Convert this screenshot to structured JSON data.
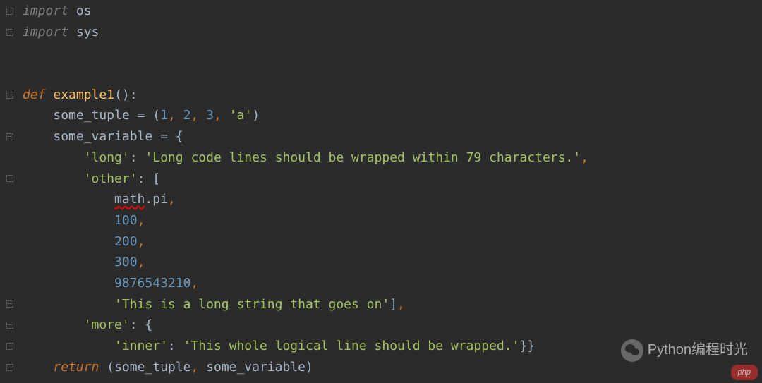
{
  "code": {
    "l1": {
      "kw": "import",
      "mod": " os"
    },
    "l2": {
      "kw": "import",
      "mod": " sys"
    },
    "l5": {
      "kw": "def ",
      "name": "example1",
      "parens": "()",
      "colon": ":"
    },
    "l6": {
      "indent": "    ",
      "var": "some_tuple ",
      "op": "= ",
      "open": "(",
      "n1": "1",
      "c1": ", ",
      "n2": "2",
      "c2": ", ",
      "n3": "3",
      "c3": ", ",
      "s1": "'a'",
      "close": ")"
    },
    "l7": {
      "indent": "    ",
      "var": "some_variable ",
      "op": "= ",
      "open": "{"
    },
    "l8": {
      "indent": "        ",
      "key": "'long'",
      "colon": ": ",
      "val": "'Long code lines should be wrapped within 79 characters.'",
      "comma": ","
    },
    "l9": {
      "indent": "        ",
      "key": "'other'",
      "colon": ": ",
      "open": "["
    },
    "l10": {
      "indent": "            ",
      "err": "math",
      "attr": ".pi",
      "comma": ","
    },
    "l11": {
      "indent": "            ",
      "num": "100",
      "comma": ","
    },
    "l12": {
      "indent": "            ",
      "num": "200",
      "comma": ","
    },
    "l13": {
      "indent": "            ",
      "num": "300",
      "comma": ","
    },
    "l14": {
      "indent": "            ",
      "num": "9876543210",
      "comma": ","
    },
    "l15": {
      "indent": "            ",
      "str": "'This is a long string that goes on'",
      "close": "]",
      "comma": ","
    },
    "l16": {
      "indent": "        ",
      "key": "'more'",
      "colon": ": ",
      "open": "{"
    },
    "l17": {
      "indent": "            ",
      "key": "'inner'",
      "colon": ": ",
      "val": "'This whole logical line should be wrapped.'",
      "close": "}}"
    },
    "l18": {
      "indent": "    ",
      "kw": "return ",
      "open": "(",
      "v1": "some_tuple",
      "c1": ", ",
      "v2": "some_variable",
      "close": ")"
    }
  },
  "watermark": {
    "text": "Python编程时光",
    "badge": "php"
  }
}
